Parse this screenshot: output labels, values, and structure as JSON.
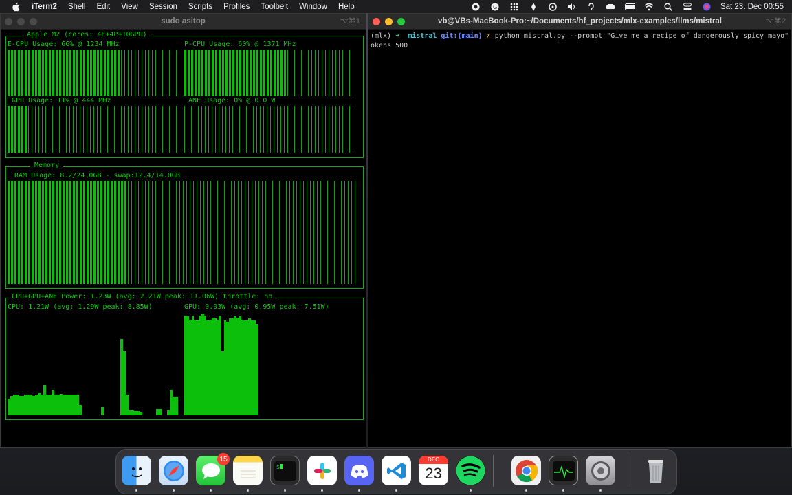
{
  "menubar": {
    "app": "iTerm2",
    "items": [
      "Shell",
      "Edit",
      "View",
      "Session",
      "Scripts",
      "Profiles",
      "Toolbelt",
      "Window",
      "Help"
    ],
    "clock": "Sat 23. Dec  00:55"
  },
  "left_window": {
    "title": "sudo asitop",
    "shortcut": "⌥⌘1",
    "cpu_box_title": "Apple M2 (cores: 4E+4P+10GPU)",
    "e_cpu_label": "E-CPU Usage: 66% @ 1234 MHz",
    "e_cpu_usage": 66,
    "p_cpu_label": "P-CPU Usage: 60% @ 1371 MHz",
    "p_cpu_usage": 60,
    "gpu_label": "GPU Usage: 11% @ 444 MHz",
    "gpu_usage": 11,
    "ane_label": "ANE Usage: 0% @ 0.0 W",
    "ane_usage": 0,
    "memory_box_title": "Memory",
    "ram_label": "RAM Usage: 8.2/24.0GB - swap:12.4/14.0GB",
    "ram_usage": 34,
    "power_box_title": "CPU+GPU+ANE Power: 1.23W (avg: 2.21W peak: 11.06W) throttle: no",
    "cpu_power_label": "CPU: 1.21W (avg: 1.29W peak: 8.85W)",
    "gpu_power_label": "GPU: 0.03W (avg: 0.95W peak: 7.51W)",
    "cpu_power_history": [
      0.16,
      0.19,
      0.2,
      0.2,
      0.19,
      0.19,
      0.2,
      0.2,
      0.2,
      0.19,
      0.2,
      0.22,
      0.2,
      0.3,
      0.2,
      0.2,
      0.25,
      0.2,
      0.2,
      0.21,
      0.2,
      0.2,
      0.2,
      0.2,
      0.2,
      0.2,
      0.1,
      0,
      0,
      0,
      0,
      0,
      0,
      0,
      0.08,
      0,
      0,
      0,
      0,
      0,
      0,
      0.75,
      0.63,
      0.2,
      0.05,
      0.05,
      0.04,
      0.04,
      0.03,
      0,
      0,
      0,
      0,
      0,
      0.06,
      0.06,
      0,
      0,
      0.05,
      0.25,
      0.18,
      0.18
    ],
    "gpu_power_history": [
      0.98,
      0.97,
      0.94,
      0.98,
      0.94,
      0.93,
      0.98,
      1.0,
      0.98,
      0.93,
      0.94,
      0.96,
      0.95,
      0.93,
      0.98,
      0.63,
      0.93,
      0.92,
      0.95,
      0.95,
      0.97,
      0.96,
      0.97,
      0.94,
      0.93,
      0.93,
      0.95,
      0.93,
      0.93,
      0.9
    ]
  },
  "right_window": {
    "title": "vb@VBs-MacBook-Pro:~/Documents/hf_projects/mlx-examples/llms/mistral",
    "shortcut": "⌥⌘2",
    "prompt_env": "(mlx)",
    "prompt_arrow": "➜",
    "prompt_dir": "mistral",
    "prompt_git": "git:(main)",
    "prompt_x": "✗",
    "command_line1": "python mistral.py --prompt \"Give me a recipe of dangerously spicy mayo\" --max-t",
    "command_line2": "okens 500"
  },
  "dock": {
    "messages_badge": "15",
    "calendar_month": "DEC",
    "calendar_day": "23",
    "apps": [
      "finder-icon",
      "safari-icon",
      "messages-icon",
      "notes-icon",
      "terminal-icon",
      "slack-icon",
      "discord-icon",
      "vscode-icon",
      "calendar-icon",
      "spotify-icon",
      "chrome-icon",
      "activity-monitor-icon",
      "system-settings-icon",
      "trash-icon"
    ]
  },
  "colors": {
    "terminal_green": "#0bbf0b",
    "border_green": "#1fa41f",
    "background": "#000000"
  }
}
